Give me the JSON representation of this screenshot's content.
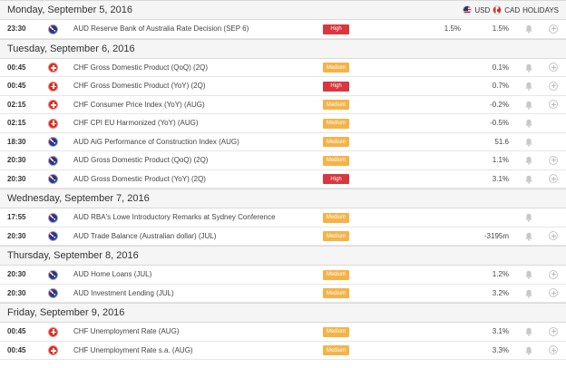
{
  "legend": {
    "usd": "USD",
    "cad": "CAD",
    "holidays": "HOLIDAYS"
  },
  "days": [
    {
      "label": "Monday, September 5, 2016",
      "events": [
        {
          "time": "23:30",
          "flag": "aud",
          "event": "AUD Reserve Bank of Australia Rate Decision (SEP 6)",
          "impact": "High",
          "impact_level": "high",
          "actual": "",
          "forecast": "1.5%",
          "previous": "1.5%",
          "bell": true,
          "add": true
        }
      ]
    },
    {
      "label": "Tuesday, September 6, 2016",
      "events": [
        {
          "time": "00:45",
          "flag": "chf",
          "event": "CHF Gross Domestic Product (QoQ) (2Q)",
          "impact": "Medium",
          "impact_level": "medium",
          "actual": "",
          "forecast": "",
          "previous": "0.1%",
          "bell": true,
          "add": true
        },
        {
          "time": "00:45",
          "flag": "chf",
          "event": "CHF Gross Domestic Product (YoY) (2Q)",
          "impact": "High",
          "impact_level": "high",
          "actual": "",
          "forecast": "",
          "previous": "0.7%",
          "bell": true,
          "add": true
        },
        {
          "time": "02:15",
          "flag": "chf",
          "event": "CHF Consumer Price Index (YoY) (AUG)",
          "impact": "Medium",
          "impact_level": "medium",
          "actual": "",
          "forecast": "",
          "previous": "-0.2%",
          "bell": true,
          "add": true
        },
        {
          "time": "02:15",
          "flag": "chf",
          "event": "CHF CPI EU Harmonized (YoY) (AUG)",
          "impact": "Medium",
          "impact_level": "medium",
          "actual": "",
          "forecast": "",
          "previous": "-0.5%",
          "bell": true,
          "add": false
        },
        {
          "time": "18:30",
          "flag": "aud",
          "event": "AUD AiG Performance of Construction Index (AUG)",
          "impact": "Medium",
          "impact_level": "medium",
          "actual": "",
          "forecast": "",
          "previous": "51.6",
          "bell": true,
          "add": false
        },
        {
          "time": "20:30",
          "flag": "aud",
          "event": "AUD Gross Domestic Product (QoQ) (2Q)",
          "impact": "Medium",
          "impact_level": "medium",
          "actual": "",
          "forecast": "",
          "previous": "1.1%",
          "bell": true,
          "add": true
        },
        {
          "time": "20:30",
          "flag": "aud",
          "event": "AUD Gross Domestic Product (YoY) (2Q)",
          "impact": "High",
          "impact_level": "high",
          "actual": "",
          "forecast": "",
          "previous": "3.1%",
          "bell": true,
          "add": true
        }
      ]
    },
    {
      "label": "Wednesday, September 7, 2016",
      "events": [
        {
          "time": "17:55",
          "flag": "aud",
          "event": "AUD RBA's Lowe Introductory Remarks at Sydney Conference",
          "impact": "Medium",
          "impact_level": "medium",
          "actual": "",
          "forecast": "",
          "previous": "",
          "bell": true,
          "add": false
        },
        {
          "time": "20:30",
          "flag": "aud",
          "event": "AUD Trade Balance (Australian dollar) (JUL)",
          "impact": "Medium",
          "impact_level": "medium",
          "actual": "",
          "forecast": "",
          "previous": "-3195m",
          "bell": true,
          "add": true
        }
      ]
    },
    {
      "label": "Thursday, September 8, 2016",
      "events": [
        {
          "time": "20:30",
          "flag": "aud",
          "event": "AUD Home Loans (JUL)",
          "impact": "Medium",
          "impact_level": "medium",
          "actual": "",
          "forecast": "",
          "previous": "1.2%",
          "bell": true,
          "add": true
        },
        {
          "time": "20:30",
          "flag": "aud",
          "event": "AUD Investment Lending (JUL)",
          "impact": "Medium",
          "impact_level": "medium",
          "actual": "",
          "forecast": "",
          "previous": "3.2%",
          "bell": true,
          "add": true
        }
      ]
    },
    {
      "label": "Friday, September 9, 2016",
      "events": [
        {
          "time": "00:45",
          "flag": "chf",
          "event": "CHF Unemployment Rate (AUG)",
          "impact": "Medium",
          "impact_level": "medium",
          "actual": "",
          "forecast": "",
          "previous": "3.1%",
          "bell": true,
          "add": true
        },
        {
          "time": "00:45",
          "flag": "chf",
          "event": "CHF Unemployment Rate s.a. (AUG)",
          "impact": "Medium",
          "impact_level": "medium",
          "actual": "",
          "forecast": "",
          "previous": "3.3%",
          "bell": true,
          "add": true
        }
      ]
    }
  ]
}
